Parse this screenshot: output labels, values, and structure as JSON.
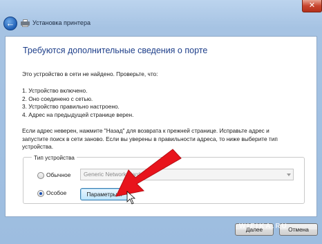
{
  "window": {
    "title": "Установка принтера",
    "close_glyph": "✕",
    "back_glyph": "←"
  },
  "content": {
    "heading": "Требуются дополнительные сведения о порте",
    "intro": "Это устройство в сети не найдено. Проверьте, что:",
    "checks": [
      "1.  Устройство включено.",
      "2.  Оно соединено с сетью.",
      "3.  Устройство правильно настроено.",
      "4.  Адрес на предыдущей странице верен."
    ],
    "advice_lines": [
      "Если адрес неверен, нажмите \"Назад\" для возврата к прежней странице.  Исправьте адрес и",
      "запустите поиск в сети заново.  Если вы уверены в правильности адреса, то ниже выберите тип",
      "устройства."
    ]
  },
  "device_type": {
    "legend": "Тип устройства",
    "option_standard": "Обычное",
    "option_custom": "Особое",
    "selected": "Особое",
    "select_value": "Generic Network Card",
    "params_button": "Параметры..."
  },
  "footer": {
    "next_button": "Далее",
    "cancel_button": "Отмена",
    "watermark": "WIFIKA.RU"
  },
  "colors": {
    "heading": "#1e3f8a",
    "annotation_arrow": "#e8141c",
    "window_frame": "#a6c3e3"
  },
  "icons": [
    "back-arrow-icon",
    "printer-icon",
    "close-icon",
    "chevron-down-icon",
    "red-arrow-annotation"
  ]
}
